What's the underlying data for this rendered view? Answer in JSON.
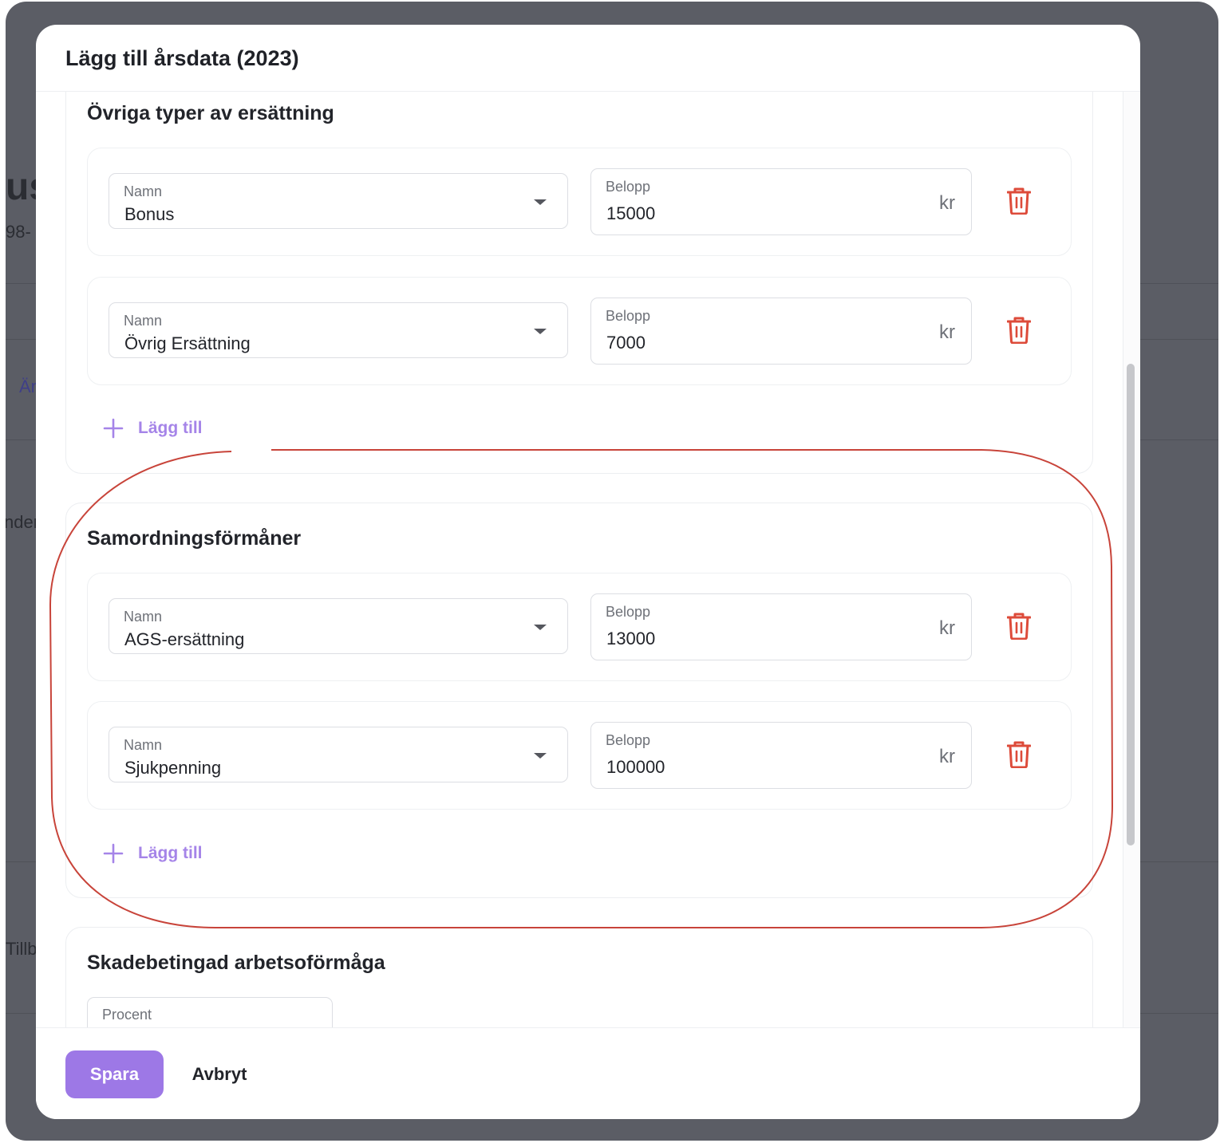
{
  "background": {
    "fragments": [
      "us",
      "98-",
      "Är",
      "nder",
      "Tillb"
    ]
  },
  "modal": {
    "title": "Lägg till årsdata (2023)"
  },
  "sections": {
    "other": {
      "title": "Övriga typer av ersättning",
      "rows": [
        {
          "name_label": "Namn",
          "name_value": "Bonus",
          "amount_label": "Belopp",
          "amount_value": "15000",
          "unit": "kr"
        },
        {
          "name_label": "Namn",
          "name_value": "Övrig Ersättning",
          "amount_label": "Belopp",
          "amount_value": "7000",
          "unit": "kr"
        }
      ],
      "add_label": "Lägg till"
    },
    "coordination": {
      "title": "Samordningsförmåner",
      "rows": [
        {
          "name_label": "Namn",
          "name_value": "AGS-ersättning",
          "amount_label": "Belopp",
          "amount_value": "13000",
          "unit": "kr"
        },
        {
          "name_label": "Namn",
          "name_value": "Sjukpenning",
          "amount_label": "Belopp",
          "amount_value": "100000",
          "unit": "kr"
        }
      ],
      "add_label": "Lägg till"
    },
    "work_capacity": {
      "title": "Skadebetingad arbetsoförmåga",
      "percent_label": "Procent"
    }
  },
  "footer": {
    "save_label": "Spara",
    "cancel_label": "Avbryt"
  },
  "colors": {
    "accent": "#9d78e6",
    "danger": "#dd4b3a",
    "annotation": "#c8443a"
  },
  "icons": [
    "trash-icon",
    "plus-icon",
    "chevron-down-icon"
  ]
}
